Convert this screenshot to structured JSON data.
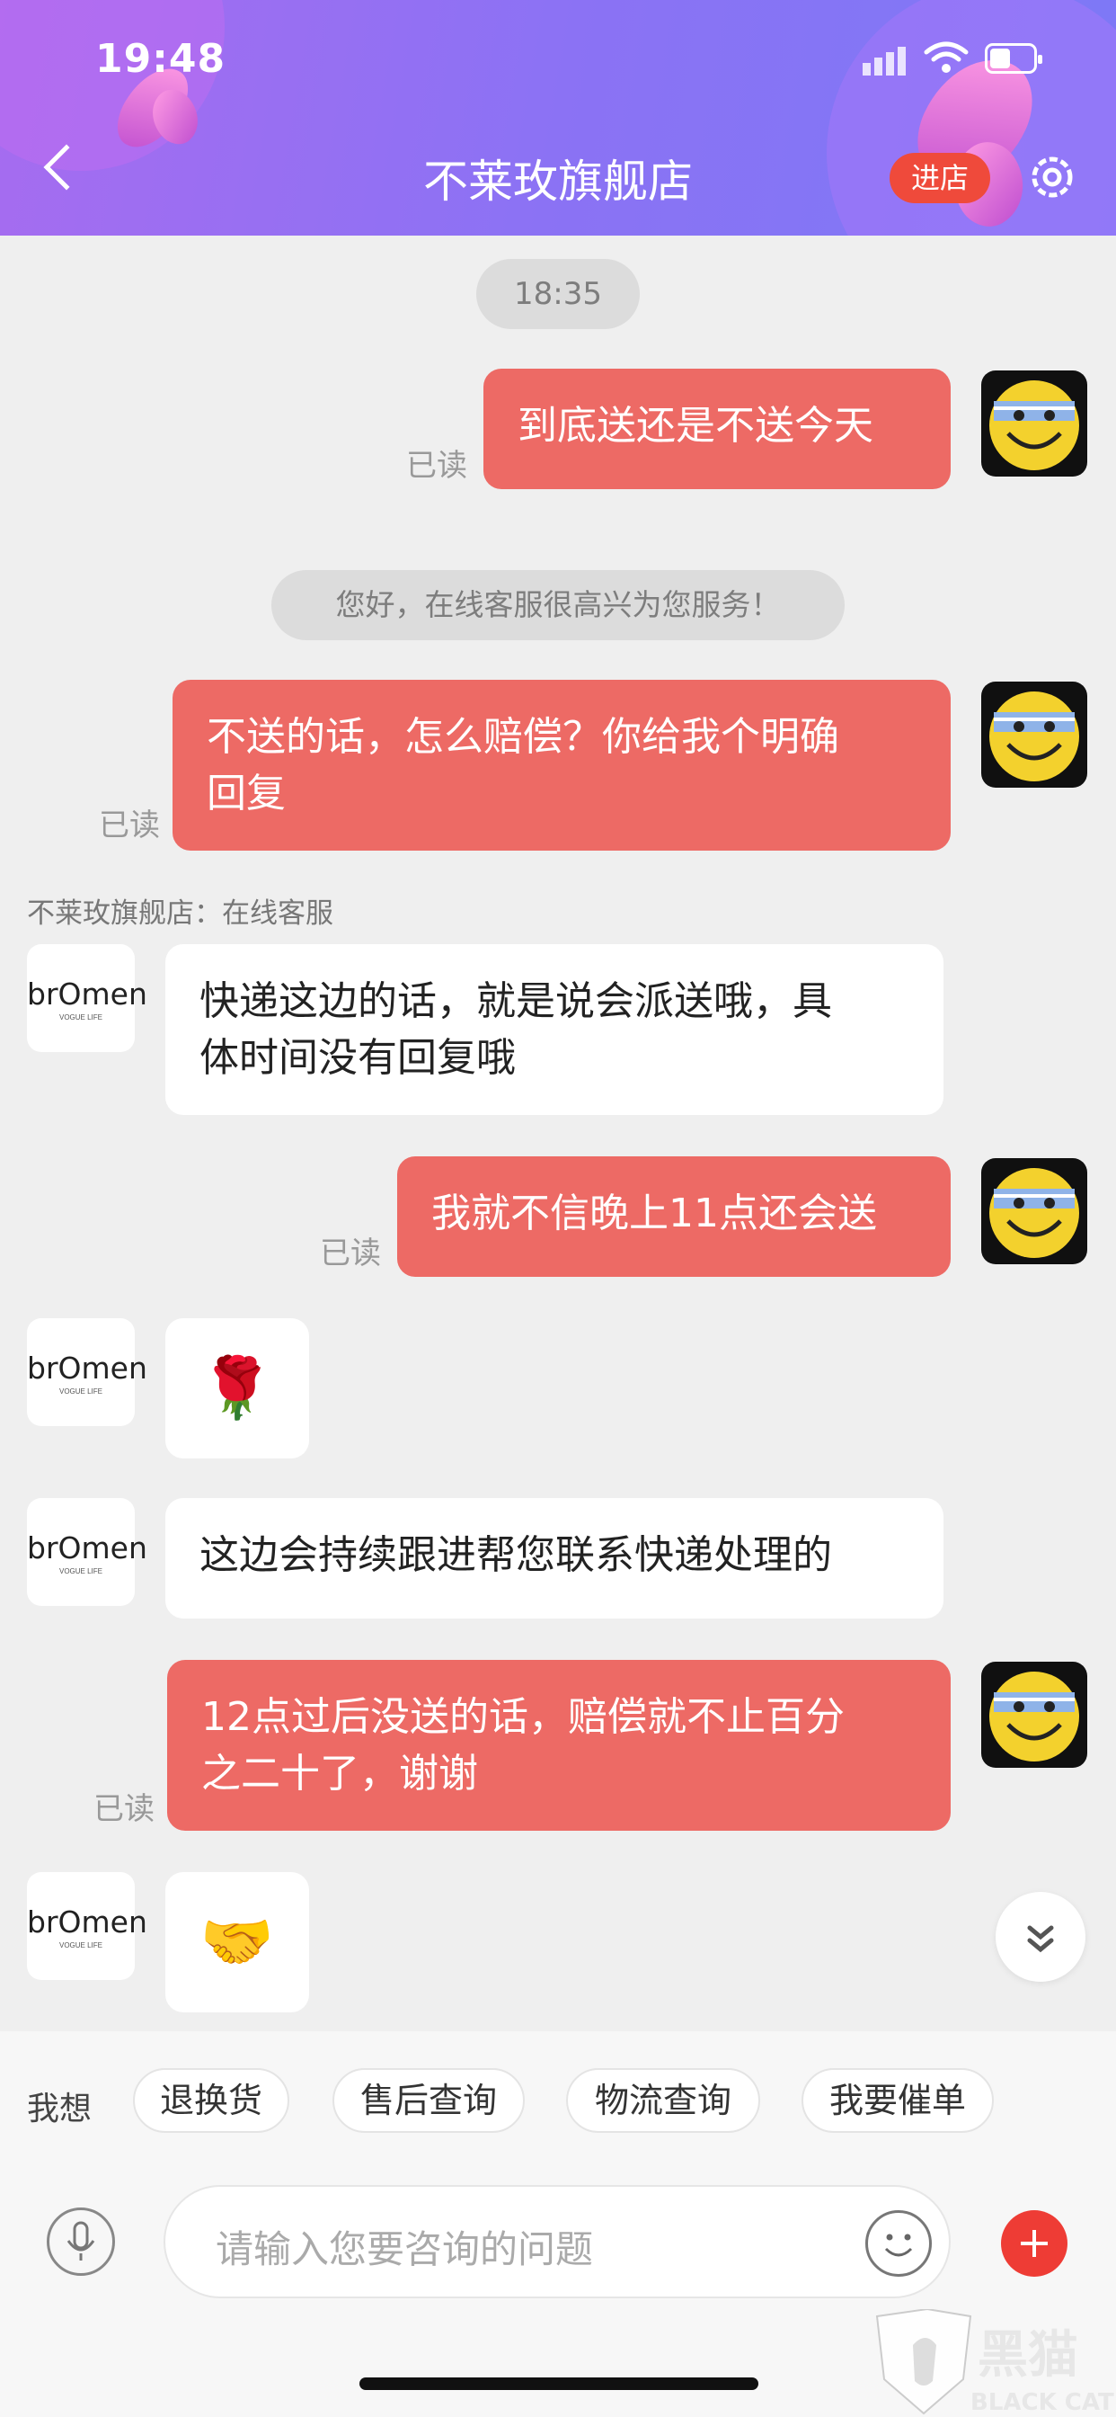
{
  "status_bar": {
    "time": "19:48"
  },
  "header": {
    "title": "不莱玫旗舰店",
    "enter_store": "进店",
    "back_icon": "chevron-left-icon",
    "settings_icon": "gear-icon"
  },
  "chat": {
    "timestamp": "18:35",
    "system_notice": "您好，在线客服很高兴为您服务！",
    "sender_label": "不莱玫旗舰店：在线客服",
    "read_label": "已读",
    "messages": [
      {
        "from": "me",
        "line1": "到底送还是不送今天",
        "line2": ""
      },
      {
        "from": "me",
        "line1": "不送的话，怎么赔偿？你给我个明确",
        "line2": "回复"
      },
      {
        "from": "shop",
        "line1": "快递这边的话，就是说会派送哦，具",
        "line2": "体时间没有回复哦"
      },
      {
        "from": "me",
        "line1": "我就不信晚上11点还会送",
        "line2": ""
      },
      {
        "from": "shop",
        "emoji": "🌹"
      },
      {
        "from": "shop",
        "line1": "这边会持续跟进帮您联系快递处理的",
        "line2": ""
      },
      {
        "from": "me",
        "line1": "12点过后没送的话，赔偿就不止百分",
        "line2": "之二十了，谢谢"
      },
      {
        "from": "shop",
        "emoji": "🤝"
      }
    ],
    "shop_avatar": {
      "logo": "brOmen",
      "tagline": "VOGUE LIFE"
    }
  },
  "quick_actions": {
    "label": "我想",
    "items": [
      "退换货",
      "售后查询",
      "物流查询",
      "我要催单"
    ]
  },
  "input": {
    "placeholder": "请输入您要咨询的问题"
  },
  "watermark": {
    "text": "黑猫",
    "sub": "BLACK CAT"
  },
  "colors": {
    "accent": "#ed6a65",
    "header_start": "#a66cf0",
    "header_end": "#7d79f6",
    "enter_button": "#ef4a3b"
  }
}
